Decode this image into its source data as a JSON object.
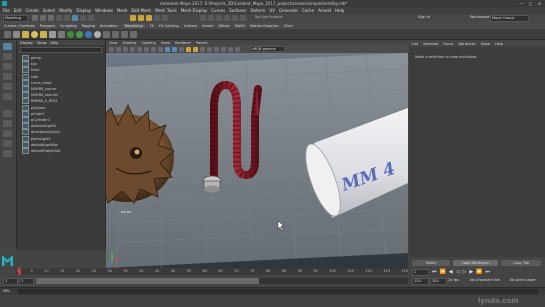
{
  "window": {
    "title": "Autodesk Maya 2017: E:\\Projects_3D\\Content_Maya_2017_project\\scenes\\simpleAnimRig.mb*",
    "min_label": "—",
    "max_label": "□",
    "close_label": "✕"
  },
  "menubar": {
    "items": [
      "File",
      "Edit",
      "Create",
      "Select",
      "Modify",
      "Display",
      "Windows",
      "Mesh",
      "Edit Mesh",
      "Mesh Tools",
      "Mesh Display",
      "Curves",
      "Surfaces",
      "Deform",
      "UV",
      "Generate",
      "Cache",
      "Arnold",
      "Help"
    ]
  },
  "statusline": {
    "menuset": "Modeling",
    "no_live_surface": "No Live Surface",
    "workspace_label": "Workspace:",
    "workspace": "Maya Classic",
    "sign_in": "Sign In"
  },
  "shelf": {
    "tabs": [
      "Curves / Surfaces",
      "Polygons",
      "Sculpting",
      "Rigging",
      "Animation",
      "Rendering",
      "FX",
      "FX Caching",
      "Custom",
      "Arnold",
      "Bifrost",
      "MASH",
      "Motion Graphics",
      "XGen"
    ],
    "active_tab": "Rendering"
  },
  "outliner": {
    "menu": [
      "Display",
      "Show",
      "Help"
    ],
    "items": [
      "persp",
      "top",
      "front",
      "side",
      "curve_head",
      "NURBS_corner",
      "NURBS_standin",
      "NURBS_2_RIGX",
      "pSphere",
      "pCube1",
      "pCylinder1",
      "ambientLight1",
      "directionalLight1",
      "pointLight1",
      "defaultLightSet",
      "defaultObjectSet"
    ]
  },
  "viewport": {
    "menu": [
      "View",
      "Shading",
      "Lighting",
      "Show",
      "Renderer",
      "Panels"
    ],
    "colorspace": "sRGB gamma",
    "camera_label": "persp",
    "object_text": "MM 4"
  },
  "attribute_editor": {
    "tabs": [
      "List",
      "Selected",
      "Focus",
      "Attributes",
      "Show",
      "Help"
    ],
    "message": "Make a selection to view attributes.",
    "buttons": [
      "Select",
      "Load Attributes",
      "Copy Tab"
    ]
  },
  "timeline": {
    "ticks": [
      "1",
      "5",
      "10",
      "15",
      "20",
      "25",
      "30",
      "35",
      "40",
      "45",
      "50",
      "55",
      "60",
      "65",
      "70",
      "75",
      "80",
      "85",
      "90",
      "95",
      "100",
      "105",
      "110",
      "115",
      "120"
    ],
    "current_frame": "1"
  },
  "range": {
    "start": "1",
    "inner_start": "1",
    "inner_end": "120",
    "end": "200",
    "fps": "24 fps",
    "no_character_set": "No Character Set",
    "no_anim_layer": "No Anim Layer"
  },
  "command": {
    "lang": "MEL"
  },
  "watermark": "lynda.com"
}
